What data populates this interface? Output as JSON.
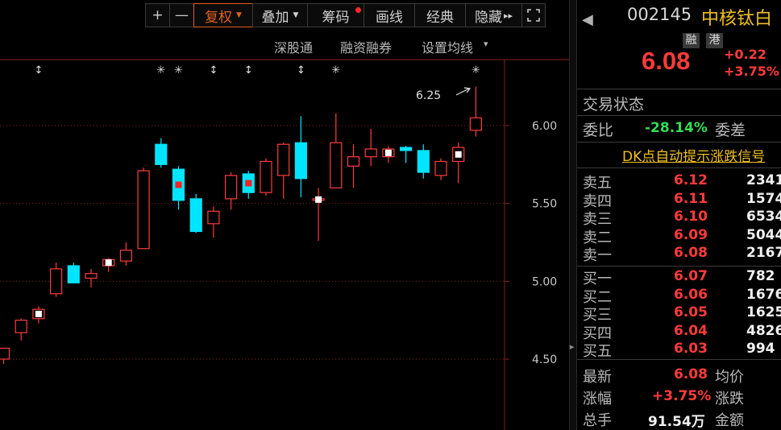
{
  "toolbar": {
    "plus": "+",
    "minus": "—",
    "fuquan": "复权",
    "diejia": "叠加",
    "chouma": "筹码",
    "huaxian": "画线",
    "jingdian": "经典",
    "yincang": "隐藏",
    "yincang_arrows": "▸▸",
    "expand_icon": "expand-icon"
  },
  "subbar": {
    "shengutong": "深股通",
    "rongzi": "融资融券",
    "set_ma": "设置均线",
    "set_ma_arrow": "▾"
  },
  "chart_data": {
    "type": "candlestick",
    "y_ticks": [
      "6.00",
      "5.50",
      "5.00",
      "4.50"
    ],
    "ylim": [
      4.47,
      6.27
    ],
    "annotation": "6.25",
    "colors": {
      "up": "#ff3b3b",
      "down": "#00e5ff",
      "grid": "#8a2020"
    },
    "candles": [
      {
        "o": 4.5,
        "h": 4.57,
        "l": 4.47,
        "c": 4.57,
        "d": "up"
      },
      {
        "o": 4.67,
        "h": 4.76,
        "l": 4.62,
        "c": 4.75,
        "d": "up"
      },
      {
        "o": 4.76,
        "h": 4.84,
        "l": 4.73,
        "c": 4.82,
        "d": "up",
        "mark": "w"
      },
      {
        "o": 4.92,
        "h": 5.12,
        "l": 4.9,
        "c": 5.08,
        "d": "up"
      },
      {
        "o": 5.1,
        "h": 5.12,
        "l": 4.99,
        "c": 4.99,
        "d": "down"
      },
      {
        "o": 5.02,
        "h": 5.08,
        "l": 4.96,
        "c": 5.05,
        "d": "up"
      },
      {
        "o": 5.1,
        "h": 5.15,
        "l": 5.06,
        "c": 5.14,
        "d": "up",
        "mark": "w"
      },
      {
        "o": 5.13,
        "h": 5.25,
        "l": 5.1,
        "c": 5.2,
        "d": "up"
      },
      {
        "o": 5.21,
        "h": 5.73,
        "l": 5.21,
        "c": 5.71,
        "d": "up"
      },
      {
        "o": 5.88,
        "h": 5.92,
        "l": 5.73,
        "c": 5.75,
        "d": "down"
      },
      {
        "o": 5.72,
        "h": 5.74,
        "l": 5.46,
        "c": 5.52,
        "d": "down",
        "mark": "r"
      },
      {
        "o": 5.53,
        "h": 5.56,
        "l": 5.31,
        "c": 5.32,
        "d": "down"
      },
      {
        "o": 5.37,
        "h": 5.48,
        "l": 5.28,
        "c": 5.45,
        "d": "up"
      },
      {
        "o": 5.53,
        "h": 5.7,
        "l": 5.46,
        "c": 5.68,
        "d": "up"
      },
      {
        "o": 5.69,
        "h": 5.71,
        "l": 5.53,
        "c": 5.57,
        "d": "down",
        "mark": "r"
      },
      {
        "o": 5.57,
        "h": 5.79,
        "l": 5.55,
        "c": 5.77,
        "d": "up"
      },
      {
        "o": 5.68,
        "h": 5.89,
        "l": 5.53,
        "c": 5.88,
        "d": "up"
      },
      {
        "o": 5.66,
        "h": 6.06,
        "l": 5.54,
        "c": 5.89,
        "d": "down"
      },
      {
        "o": 5.53,
        "h": 5.6,
        "l": 5.26,
        "c": 5.52,
        "d": "up",
        "mark": "c"
      },
      {
        "o": 5.6,
        "h": 6.08,
        "l": 5.6,
        "c": 5.89,
        "d": "up"
      },
      {
        "o": 5.74,
        "h": 5.88,
        "l": 5.6,
        "c": 5.8,
        "d": "up"
      },
      {
        "o": 5.8,
        "h": 5.98,
        "l": 5.74,
        "c": 5.85,
        "d": "up"
      },
      {
        "o": 5.8,
        "h": 5.87,
        "l": 5.76,
        "c": 5.85,
        "d": "up",
        "mark": "w"
      },
      {
        "o": 5.86,
        "h": 5.87,
        "l": 5.76,
        "c": 5.84,
        "d": "down"
      },
      {
        "o": 5.84,
        "h": 5.88,
        "l": 5.66,
        "c": 5.7,
        "d": "down"
      },
      {
        "o": 5.68,
        "h": 5.79,
        "l": 5.65,
        "c": 5.77,
        "d": "up"
      },
      {
        "o": 5.77,
        "h": 5.89,
        "l": 5.63,
        "c": 5.86,
        "d": "up",
        "mark": "w"
      },
      {
        "o": 5.97,
        "h": 6.25,
        "l": 5.93,
        "c": 6.05,
        "d": "up"
      }
    ],
    "signals": [
      {
        "i": 2,
        "t": "↕"
      },
      {
        "i": 9,
        "t": "✳"
      },
      {
        "i": 10,
        "t": "✳"
      },
      {
        "i": 12,
        "t": "↕"
      },
      {
        "i": 14,
        "t": "↕"
      },
      {
        "i": 17,
        "t": "↕"
      },
      {
        "i": 19,
        "t": "✳"
      },
      {
        "i": 27,
        "t": "✳"
      }
    ]
  },
  "stock": {
    "code": "002145",
    "name": "中核钛白",
    "tag_rong": "融",
    "tag_gang": "港",
    "price": "6.08",
    "change": "+0.22",
    "change_pct": "+3.75%",
    "back_arrow": "◀"
  },
  "status_label": "交易状态",
  "weibi": {
    "label": "委比",
    "value": "-28.14%",
    "weicha_label": "委差"
  },
  "dk_text": "DK点自动提示涨跌信号",
  "asks": [
    {
      "label": "卖五",
      "price": "6.12",
      "volume": "2341"
    },
    {
      "label": "卖四",
      "price": "6.11",
      "volume": "1574"
    },
    {
      "label": "卖三",
      "price": "6.10",
      "volume": "6534"
    },
    {
      "label": "卖二",
      "price": "6.09",
      "volume": "5044"
    },
    {
      "label": "卖一",
      "price": "6.08",
      "volume": "2167"
    }
  ],
  "bids": [
    {
      "label": "买一",
      "price": "6.07",
      "volume": "782"
    },
    {
      "label": "买二",
      "price": "6.06",
      "volume": "1676"
    },
    {
      "label": "买三",
      "price": "6.05",
      "volume": "1625"
    },
    {
      "label": "买四",
      "price": "6.04",
      "volume": "4826"
    },
    {
      "label": "买五",
      "price": "6.03",
      "volume": "994"
    }
  ],
  "stats": {
    "zuixin_label": "最新",
    "zuixin": "6.08",
    "junjia_label": "均价",
    "zhangfu_label": "涨幅",
    "zhangfu": "+3.75%",
    "zhangdie_label": "涨跌",
    "zongshou_label": "总手",
    "zongshou": "91.54万",
    "jine_label": "金额"
  },
  "divider_arrow": "▸"
}
